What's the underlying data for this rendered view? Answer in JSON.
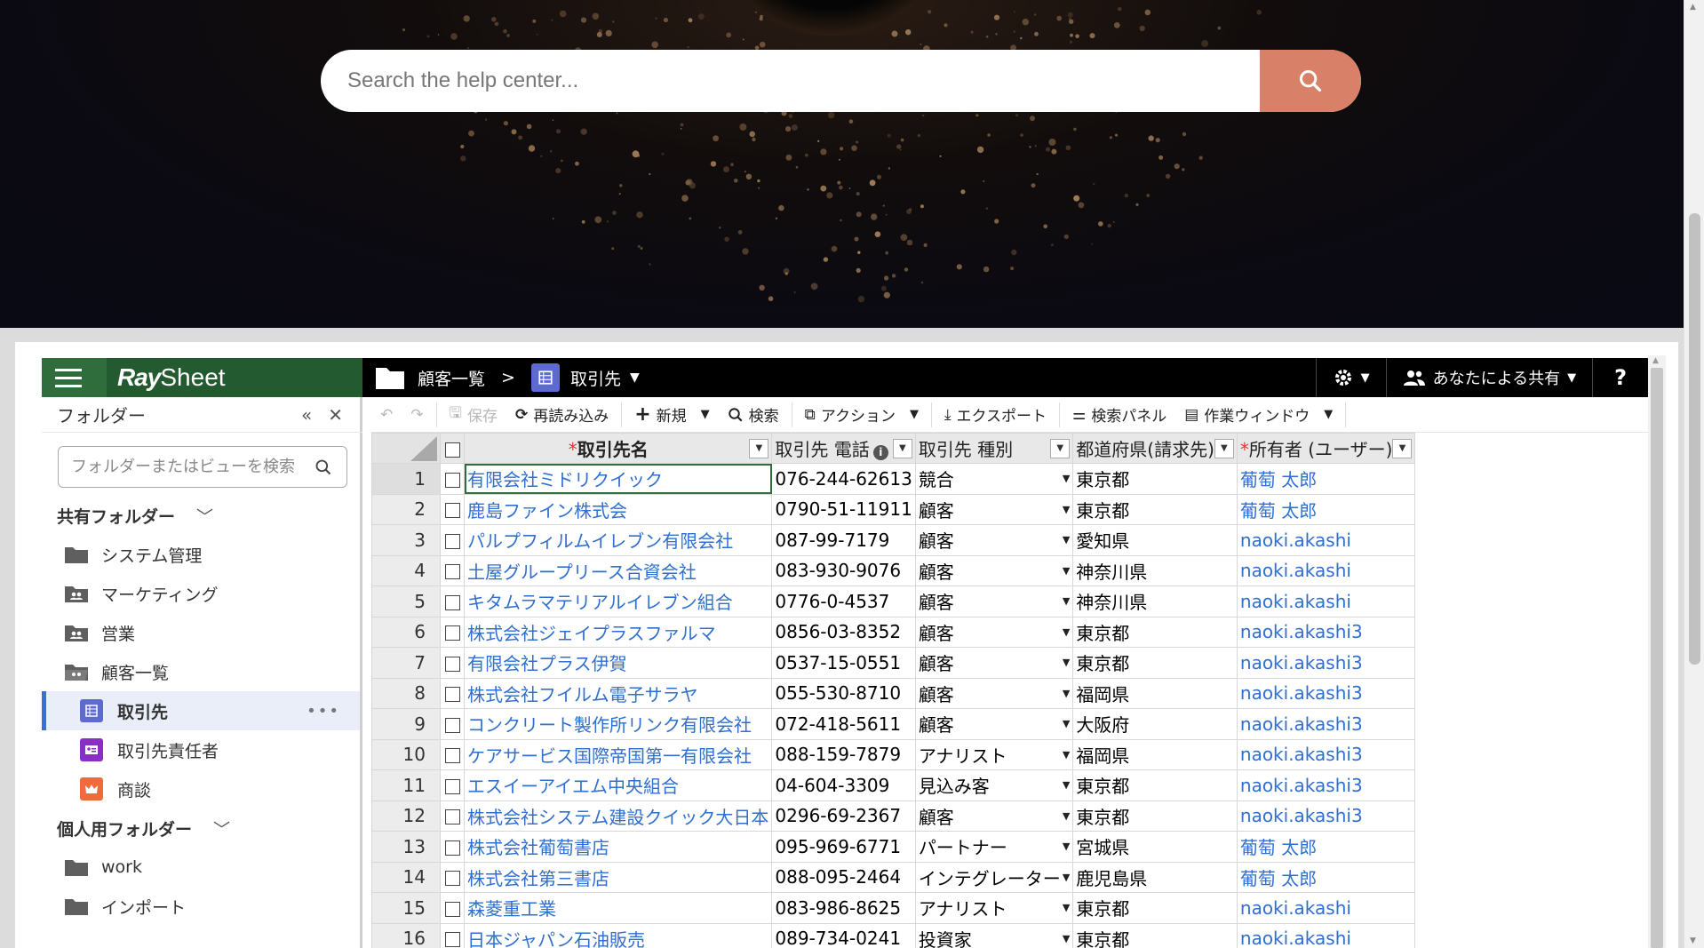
{
  "help_search": {
    "placeholder": "Search the help center..."
  },
  "sidebar": {
    "logo": {
      "ray": "Ray",
      "sheet": "Sheet"
    },
    "panel_title": "フォルダー",
    "search_placeholder": "フォルダーまたはビューを検索",
    "shared_section": "共有フォルダー",
    "shared_items": [
      "システム管理",
      "マーケティング",
      "営業",
      "顧客一覧"
    ],
    "views": [
      {
        "label": "取引先",
        "color": "#5d6bd0"
      },
      {
        "label": "取引先責任者",
        "color": "#8a2fc3"
      },
      {
        "label": "商談",
        "color": "#f06b3a"
      }
    ],
    "more": "•••",
    "personal_section": "個人用フォルダー",
    "personal_items": [
      "work",
      "インポート"
    ]
  },
  "topbar": {
    "crumb_parent": "顧客一覧",
    "crumb_sep": ">",
    "crumb_current": "取引先",
    "share_label": "あなたによる共有",
    "help": "?"
  },
  "toolbar": {
    "save": "保存",
    "reload": "再読み込み",
    "new": "新規",
    "search": "検索",
    "action": "アクション",
    "export": "エクスポート",
    "search_panel": "検索パネル",
    "work_window": "作業ウィンドウ"
  },
  "grid": {
    "columns": [
      {
        "label": "取引先名",
        "required": true
      },
      {
        "label": "取引先 電話",
        "info": true
      },
      {
        "label": "取引先 種別"
      },
      {
        "label": "都道府県(請求先)"
      },
      {
        "label": "所有者 (ユーザー)",
        "required": true
      }
    ],
    "rows": [
      {
        "num": "1",
        "name": "有限会社ミドリクイック",
        "phone": "076-244-62613",
        "type": "競合",
        "pref": "東京都",
        "owner": "葡萄 太郎"
      },
      {
        "num": "2",
        "name": "鹿島ファイン株式会",
        "phone": "0790-51-11911",
        "type": "顧客",
        "pref": "東京都",
        "owner": "葡萄 太郎"
      },
      {
        "num": "3",
        "name": "パルプフィルムイレブン有限会社",
        "phone": "087-99-7179",
        "type": "顧客",
        "pref": "愛知県",
        "owner": "naoki.akashi"
      },
      {
        "num": "4",
        "name": "土屋グループリース合資会社",
        "phone": "083-930-9076",
        "type": "顧客",
        "pref": "神奈川県",
        "owner": "naoki.akashi"
      },
      {
        "num": "5",
        "name": "キタムラマテリアルイレブン組合",
        "phone": "0776-0-4537",
        "type": "顧客",
        "pref": "神奈川県",
        "owner": "naoki.akashi"
      },
      {
        "num": "6",
        "name": "株式会社ジェイプラスファルマ",
        "phone": "0856-03-8352",
        "type": "顧客",
        "pref": "東京都",
        "owner": "naoki.akashi3"
      },
      {
        "num": "7",
        "name": "有限会社プラス伊賀",
        "phone": "0537-15-0551",
        "type": "顧客",
        "pref": "東京都",
        "owner": "naoki.akashi3"
      },
      {
        "num": "8",
        "name": "株式会社フイルム電子サラヤ",
        "phone": "055-530-8710",
        "type": "顧客",
        "pref": "福岡県",
        "owner": "naoki.akashi3"
      },
      {
        "num": "9",
        "name": "コンクリート製作所リンク有限会社",
        "phone": "072-418-5611",
        "type": "顧客",
        "pref": "大阪府",
        "owner": "naoki.akashi3"
      },
      {
        "num": "10",
        "name": "ケアサービス国際帝国第一有限会社",
        "phone": "088-159-7879",
        "type": "アナリスト",
        "pref": "福岡県",
        "owner": "naoki.akashi3"
      },
      {
        "num": "11",
        "name": "エスイーアイエム中央組合",
        "phone": "04-604-3309",
        "type": "見込み客",
        "pref": "東京都",
        "owner": "naoki.akashi3"
      },
      {
        "num": "12",
        "name": "株式会社システム建設クイック大日本",
        "phone": "0296-69-2367",
        "type": "顧客",
        "pref": "東京都",
        "owner": "naoki.akashi3"
      },
      {
        "num": "13",
        "name": "株式会社葡萄書店",
        "phone": "095-969-6771",
        "type": "パートナー",
        "pref": "宮城県",
        "owner": "葡萄 太郎"
      },
      {
        "num": "14",
        "name": "株式会社第三書店",
        "phone": "088-095-2464",
        "type": "インテグレーター",
        "pref": "鹿児島県",
        "owner": "葡萄 太郎"
      },
      {
        "num": "15",
        "name": "森菱重工業",
        "phone": "083-986-8625",
        "type": "アナリスト",
        "pref": "東京都",
        "owner": "naoki.akashi"
      },
      {
        "num": "16",
        "name": "日本ジャパン石油販売",
        "phone": "089-734-0241",
        "type": "投資家",
        "pref": "東京都",
        "owner": "naoki.akashi"
      }
    ]
  }
}
